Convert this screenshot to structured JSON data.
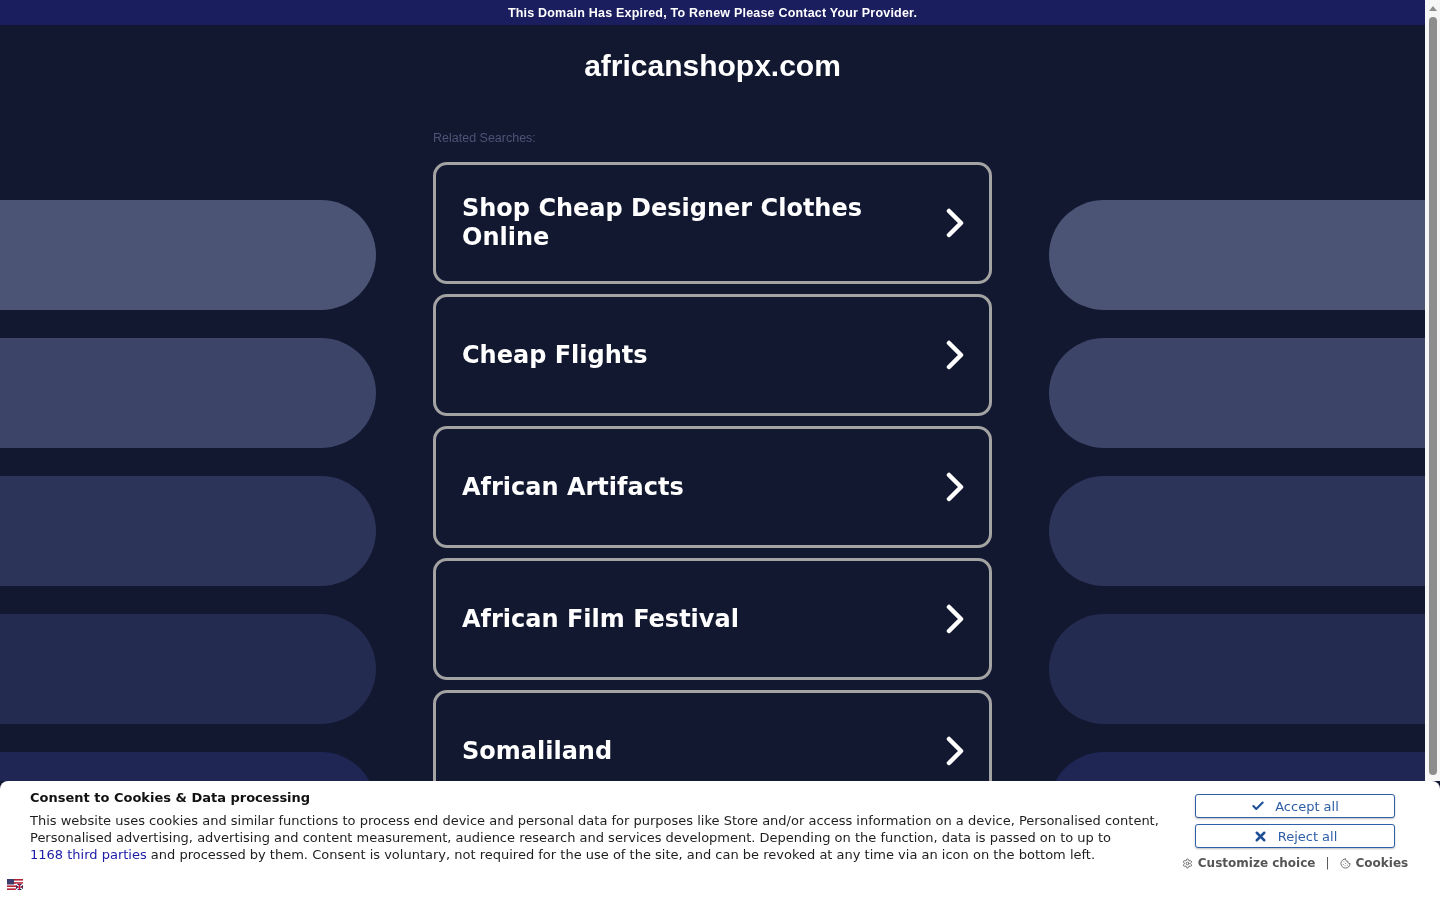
{
  "notice_bar": {
    "text": "This Domain Has Expired, To Renew Please Contact Your Provider."
  },
  "site_title": "africanshopx.com",
  "related_searches": {
    "label": "Related Searches:",
    "items": [
      {
        "label": "Shop Cheap Designer Clothes Online"
      },
      {
        "label": "Cheap Flights"
      },
      {
        "label": "African Artifacts"
      },
      {
        "label": "African Film Festival"
      },
      {
        "label": "Somaliland"
      }
    ]
  },
  "cookie_consent": {
    "title": "Consent to Cookies & Data processing",
    "text_before": "This website uses cookies and similar functions to process end device and personal data for purposes like Store and/or access information on a device, Personalised content, Personalised advertising, advertising and content measurement, audience research and services development. Depending on the function, data is passed on to up to",
    "link": "1168 third parties",
    "text_after": "and processed by them. Consent is voluntary, not required for the use of the site, and can be revoked at any time via an icon on the bottom left.",
    "buttons": [
      {
        "kind": "accept",
        "label": "Accept all"
      },
      {
        "kind": "reject",
        "label": "Reject all"
      }
    ],
    "links": [
      {
        "kind": "customize",
        "label": "Customize choice"
      },
      {
        "kind": "cookies",
        "label": "Cookies"
      }
    ],
    "separator": "|"
  }
}
